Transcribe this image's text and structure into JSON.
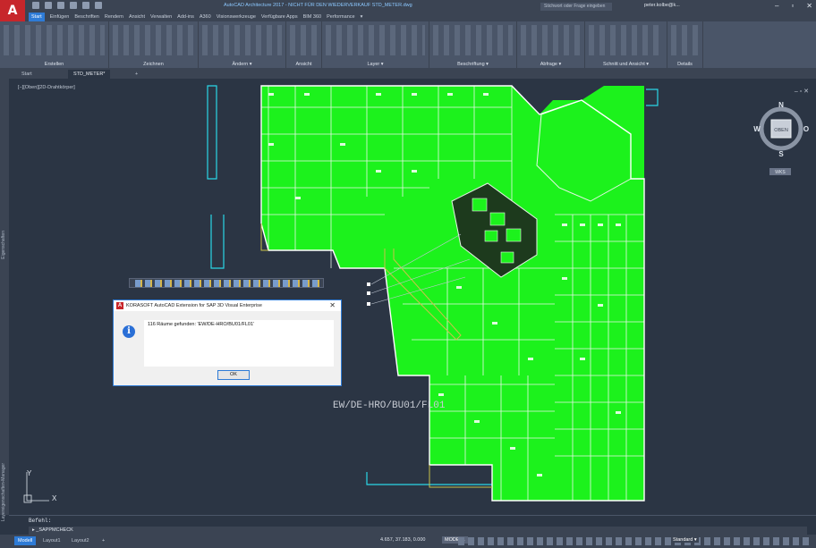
{
  "app": {
    "logo": "A",
    "window_title": "AutoCAD Architecture 2017 - NICHT FÜR DEN WIEDERVERKAUF   STD_METER.dwg",
    "search_placeholder": "Stichwort oder Frage eingeben",
    "user": "peter.kolbe@k..."
  },
  "menu": [
    "Start",
    "Einfügen",
    "Beschriften",
    "Rendern",
    "Ansicht",
    "Verwalten",
    "Add-ins",
    "A360",
    "Visionswerkzeuge",
    "Verfügbare Apps",
    "BIM 360",
    "Performance"
  ],
  "ribbon_panels": [
    "Erstellen",
    "Zeichnen",
    "Ändern ▾",
    "Ansicht",
    "Layer ▾",
    "Beschriftung ▾",
    "Abfrage ▾",
    "Schnitt und Ansicht ▾",
    "Details"
  ],
  "doc_tabs": [
    "Start",
    "STD_METER*"
  ],
  "viewport_label": "[−][Oben][2D-Drahtkörper]",
  "side_labels": [
    "Eigenschaften",
    "Layereigenschaften-Manager"
  ],
  "viewcube": {
    "n": "N",
    "s": "S",
    "w": "W",
    "o": "O",
    "face": "OBEN",
    "wks": "WKS"
  },
  "drawing_label": "EW/DE-HRO/BU01/FL01",
  "ucs": {
    "x": "X",
    "y": "Y"
  },
  "dialog": {
    "title": "KORASOFT AutoCAD Extension for SAP 3D Visual Enterprise",
    "message": "116 Räume gefunden: 'EW/DE-HRO/BU01/FL01'",
    "ok": "OK",
    "close": "✕"
  },
  "command": {
    "history": "Befehl:",
    "input": "▸ _SAPPMCHECK"
  },
  "status": {
    "tabs": [
      "Modell",
      "Layout1",
      "Layout2",
      "+"
    ],
    "coords": "4.657, 37.183, 0.000",
    "mode": "MODELL",
    "style": "Standard ▾"
  },
  "colors": {
    "room_fill": "#1cf21c",
    "wall": "#e8f5e8",
    "cyan_lines": "#2bd6e6",
    "accent": "#2e7bd6"
  }
}
